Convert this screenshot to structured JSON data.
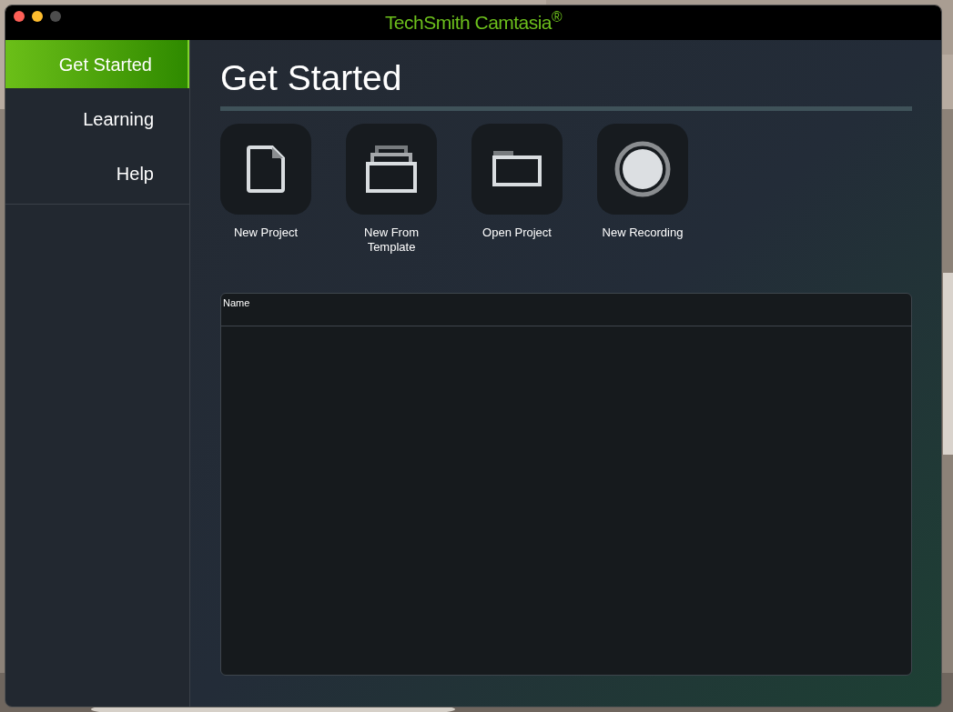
{
  "window": {
    "title": "TechSmith Camtasia$^{®}$"
  },
  "sidebar": {
    "items": [
      {
        "label": "Get Started",
        "selected": true
      },
      {
        "label": "Learning",
        "selected": false
      },
      {
        "label": "Help",
        "selected": false
      }
    ]
  },
  "main": {
    "heading": "Get Started",
    "actions": [
      {
        "kind": "document",
        "label": "New Project"
      },
      {
        "kind": "template",
        "label": "New From Template"
      },
      {
        "kind": "folder",
        "label": "Open Project"
      },
      {
        "kind": "record",
        "label": "New Recording"
      }
    ],
    "table": {
      "columns": [
        "Name"
      ]
    }
  }
}
